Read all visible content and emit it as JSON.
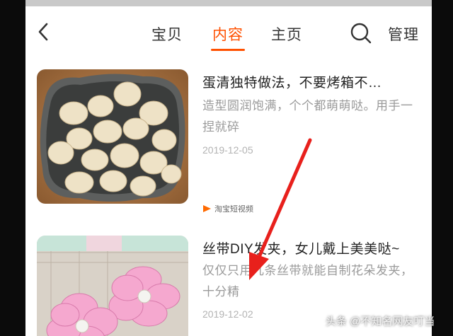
{
  "header": {
    "tabs": [
      {
        "label": "宝贝",
        "active": false
      },
      {
        "label": "内容",
        "active": true
      },
      {
        "label": "主页",
        "active": false
      }
    ],
    "manage_label": "管理",
    "accent_color": "#ff5000"
  },
  "items": [
    {
      "title": "蛋清独特做法，不要烤箱不…",
      "desc": "造型圆润饱满，个个都萌萌哒。用手一捏就碎",
      "date": "2019-12-05",
      "source": "淘宝短视频"
    },
    {
      "title": "丝带DIY发夹，女儿戴上美美哒~",
      "desc": "仅仅只用几条丝带就能自制花朵发夹，十分精",
      "date": "2019-12-02"
    }
  ],
  "watermark": "头条 @不知名网友叮当",
  "icons": [
    "back-arrow-icon",
    "search-icon",
    "play-source-icon",
    "red-arrow-annotation"
  ]
}
